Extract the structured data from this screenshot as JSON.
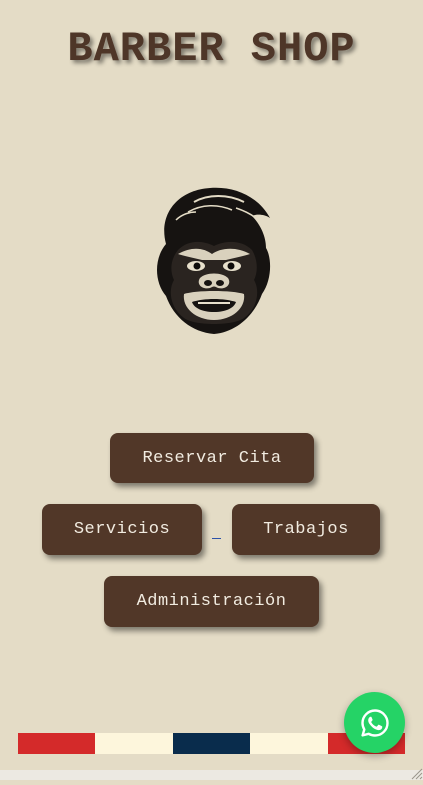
{
  "header": {
    "title": "BARBER SHOP"
  },
  "logo": {
    "icon": "gorilla-head-logo"
  },
  "menu": {
    "reservar_label": "Reservar Cita",
    "servicios_label": "Servicios",
    "trabajos_label": "Trabajos",
    "admin_label": "Administración"
  },
  "footer": {
    "stripe_colors": [
      "#d42a2a",
      "#fdf6dc",
      "#092c4c",
      "#fdf6dc",
      "#d42a2a"
    ]
  },
  "whatsapp": {
    "icon": "whatsapp-icon",
    "color": "#25d366"
  },
  "theme": {
    "background": "#e4dcc6",
    "button_bg": "#513728",
    "title_color": "#4e3628"
  }
}
